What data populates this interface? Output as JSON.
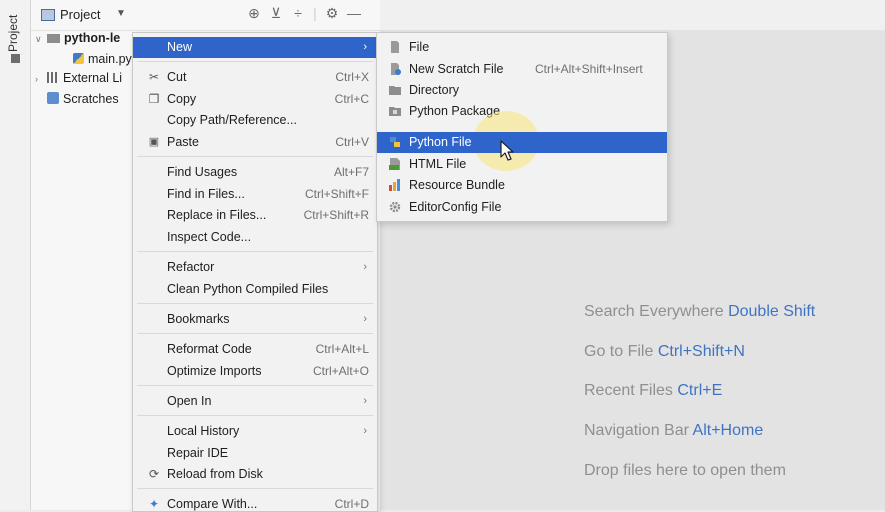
{
  "side_tab": {
    "label": "Project"
  },
  "panel": {
    "title": "Project",
    "tree": [
      {
        "label": "python-le",
        "kind": "folder",
        "expanded": true
      },
      {
        "label": "main.py",
        "kind": "python-file"
      },
      {
        "label": "External Li",
        "kind": "libraries"
      },
      {
        "label": "Scratches",
        "kind": "scratches"
      }
    ]
  },
  "context_menu": {
    "items": [
      {
        "label": "New",
        "shortcut": "",
        "submenu": true,
        "selected": true,
        "icon": ""
      },
      {
        "label": "Cut",
        "shortcut": "Ctrl+X",
        "icon": "✂"
      },
      {
        "label": "Copy",
        "shortcut": "Ctrl+C",
        "icon": "❐"
      },
      {
        "label": "Copy Path/Reference...",
        "shortcut": "",
        "icon": ""
      },
      {
        "label": "Paste",
        "shortcut": "Ctrl+V",
        "icon": "📋"
      },
      {
        "label": "Find Usages",
        "shortcut": "Alt+F7",
        "icon": ""
      },
      {
        "label": "Find in Files...",
        "shortcut": "Ctrl+Shift+F",
        "icon": ""
      },
      {
        "label": "Replace in Files...",
        "shortcut": "Ctrl+Shift+R",
        "icon": ""
      },
      {
        "label": "Inspect Code...",
        "shortcut": "",
        "icon": ""
      },
      {
        "label": "Refactor",
        "shortcut": "",
        "submenu": true,
        "icon": ""
      },
      {
        "label": "Clean Python Compiled Files",
        "shortcut": "",
        "icon": ""
      },
      {
        "label": "Bookmarks",
        "shortcut": "",
        "submenu": true,
        "icon": ""
      },
      {
        "label": "Reformat Code",
        "shortcut": "Ctrl+Alt+L",
        "icon": ""
      },
      {
        "label": "Optimize Imports",
        "shortcut": "Ctrl+Alt+O",
        "icon": ""
      },
      {
        "label": "Open In",
        "shortcut": "",
        "submenu": true,
        "icon": ""
      },
      {
        "label": "Local History",
        "shortcut": "",
        "submenu": true,
        "icon": ""
      },
      {
        "label": "Repair IDE",
        "shortcut": "",
        "icon": ""
      },
      {
        "label": "Reload from Disk",
        "shortcut": "",
        "icon": "⟳"
      },
      {
        "label": "Compare With...",
        "shortcut": "Ctrl+D",
        "icon": "✦"
      }
    ]
  },
  "new_submenu": {
    "items": [
      {
        "label": "File",
        "shortcut": "",
        "icon": "file-icon"
      },
      {
        "label": "New Scratch File",
        "shortcut": "Ctrl+Alt+Shift+Insert",
        "icon": "scratch-file-icon"
      },
      {
        "label": "Directory",
        "shortcut": "",
        "icon": "folder-icon"
      },
      {
        "label": "Python Package",
        "shortcut": "",
        "icon": "package-icon"
      },
      {
        "label": "Python File",
        "shortcut": "",
        "icon": "python-icon",
        "selected": true
      },
      {
        "label": "HTML File",
        "shortcut": "",
        "icon": "html-icon"
      },
      {
        "label": "Resource Bundle",
        "shortcut": "",
        "icon": "bundle-icon"
      },
      {
        "label": "EditorConfig File",
        "shortcut": "",
        "icon": "gear-icon"
      }
    ]
  },
  "editor_hints": [
    {
      "text": "Search Everywhere ",
      "key": "Double Shift"
    },
    {
      "text": "Go to File ",
      "key": "Ctrl+Shift+N"
    },
    {
      "text": "Recent Files ",
      "key": "Ctrl+E"
    },
    {
      "text": "Navigation Bar ",
      "key": "Alt+Home"
    },
    {
      "text": "Drop files here to open them",
      "key": ""
    }
  ],
  "colors": {
    "selection": "#2f65ca",
    "hint_key": "#3f74c3",
    "hint_text": "#8f8f8f"
  }
}
